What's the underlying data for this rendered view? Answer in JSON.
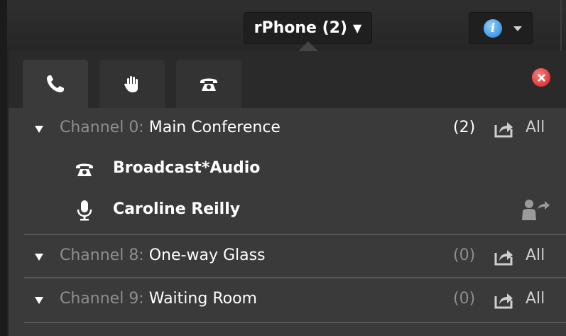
{
  "device_selector": {
    "label": "rPhone (2)",
    "caret": "▼"
  },
  "info_button": {
    "glyph": "i",
    "icon": "info-icon"
  },
  "tabs": [
    {
      "icon": "phone-icon",
      "active": true
    },
    {
      "icon": "hand-icon",
      "active": false
    },
    {
      "icon": "telephone-icon",
      "active": false
    }
  ],
  "close": {
    "icon": "close-icon",
    "color": "#e53b3b"
  },
  "channels": [
    {
      "prefix": "Channel 0:",
      "name": "Main Conference",
      "count": "(2)",
      "count_active": true,
      "all_label": "All",
      "members": [
        {
          "icon": "telephone-icon",
          "name": "Broadcast*Audio"
        },
        {
          "icon": "microphone-icon",
          "name": "Caroline Reilly",
          "action_icon": "transfer-user-icon"
        }
      ]
    },
    {
      "prefix": "Channel 8:",
      "name": "One-way Glass",
      "count": "(0)",
      "count_active": false,
      "all_label": "All",
      "members": []
    },
    {
      "prefix": "Channel 9:",
      "name": "Waiting Room",
      "count": "(0)",
      "count_active": false,
      "all_label": "All",
      "members": []
    }
  ],
  "colors": {
    "accent_info": "#1e7fd6",
    "close_red": "#d21f1f",
    "panel_bg": "#3a3a3a",
    "muted_text": "#8e8e8e"
  }
}
